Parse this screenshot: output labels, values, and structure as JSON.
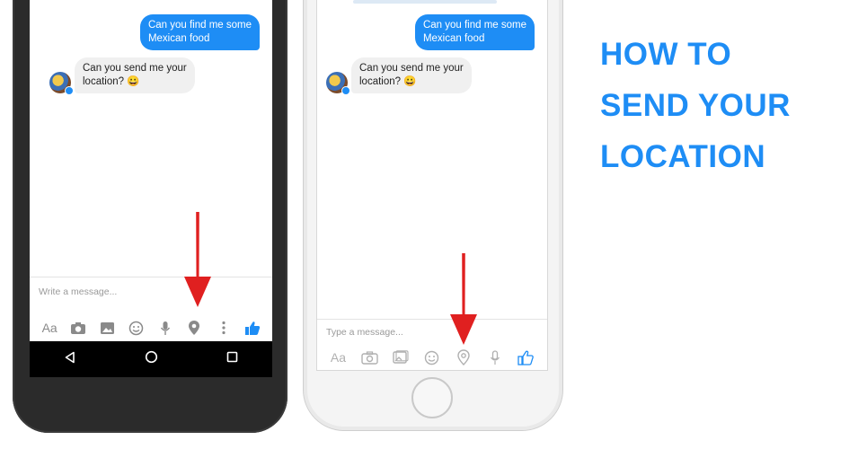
{
  "headline": {
    "line1": "HOW TO",
    "line2": "SEND YOUR",
    "line3": "LOCATION"
  },
  "android": {
    "outgoing_message": "Can you find me some\nMexican food",
    "incoming_message": "Can you send me your\nlocation? 😀",
    "composer_placeholder": "Write a message...",
    "aa_label": "Aa",
    "toolbar_icons": [
      "aa-icon",
      "camera-icon",
      "gallery-icon",
      "emoji-icon",
      "microphone-icon",
      "location-pin-icon",
      "more-icon",
      "like-icon"
    ],
    "nav_icons": [
      "back-icon",
      "home-icon",
      "recents-icon"
    ]
  },
  "iphone": {
    "outgoing_message": "Can you find me some\nMexican food",
    "incoming_message": "Can you send me your\nlocation? 😀",
    "composer_placeholder": "Type a message...",
    "aa_label": "Aa",
    "toolbar_icons": [
      "aa-icon",
      "camera-icon",
      "gallery-icon",
      "emoji-icon",
      "location-pin-icon",
      "microphone-icon",
      "like-icon"
    ]
  },
  "colors": {
    "accent_blue": "#1e8df5",
    "arrow_red": "#e02020"
  }
}
